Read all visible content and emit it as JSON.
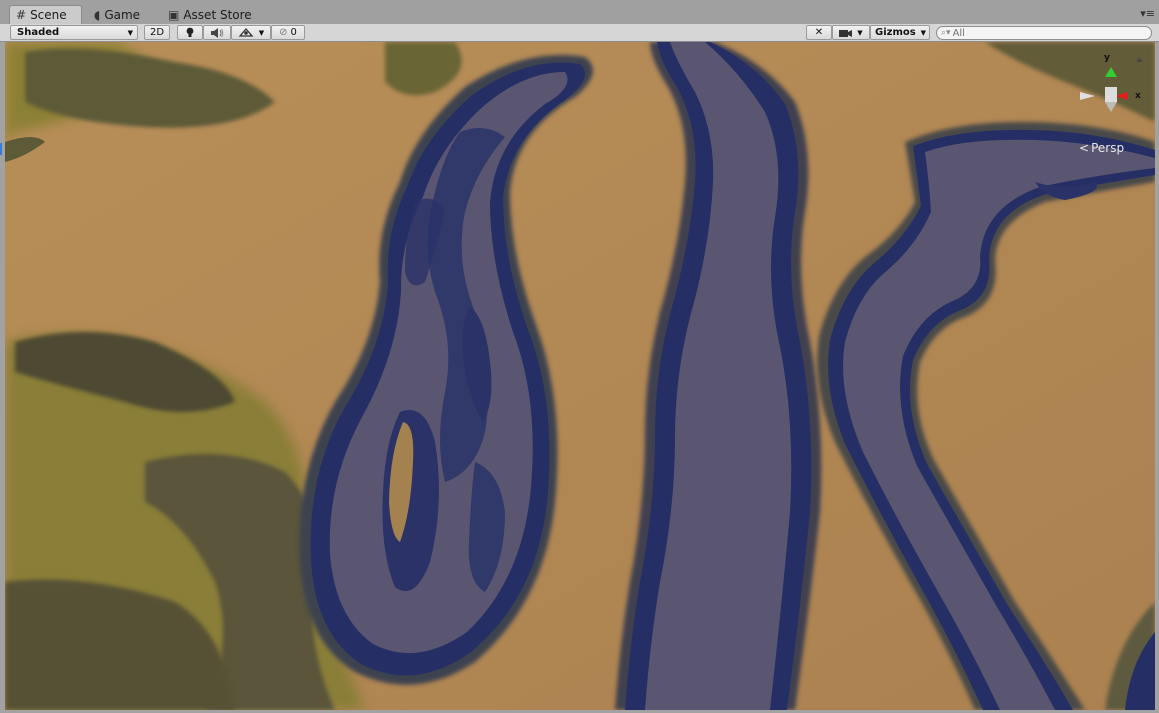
{
  "tabs": [
    {
      "label": "Scene",
      "icon": "grid-icon",
      "active": true
    },
    {
      "label": "Game",
      "icon": "pacman-icon",
      "active": false
    },
    {
      "label": "Asset Store",
      "icon": "bag-icon",
      "active": false
    }
  ],
  "toolbar": {
    "shading_mode": "Shaded",
    "mode_2d": "2D",
    "hidden_count": "0",
    "gizmos_label": "Gizmos",
    "search_placeholder": "All"
  },
  "scene_gizmo": {
    "y_label": "y",
    "x_label": "x",
    "projection_label": "Persp"
  },
  "colors": {
    "sand": "#b48a55",
    "water": "#252f65",
    "river_bed": "#5a5671",
    "grass": "#8c8036",
    "rock": "#5b5634",
    "gizmo_y": "#33cc33",
    "gizmo_x": "#e02020"
  }
}
